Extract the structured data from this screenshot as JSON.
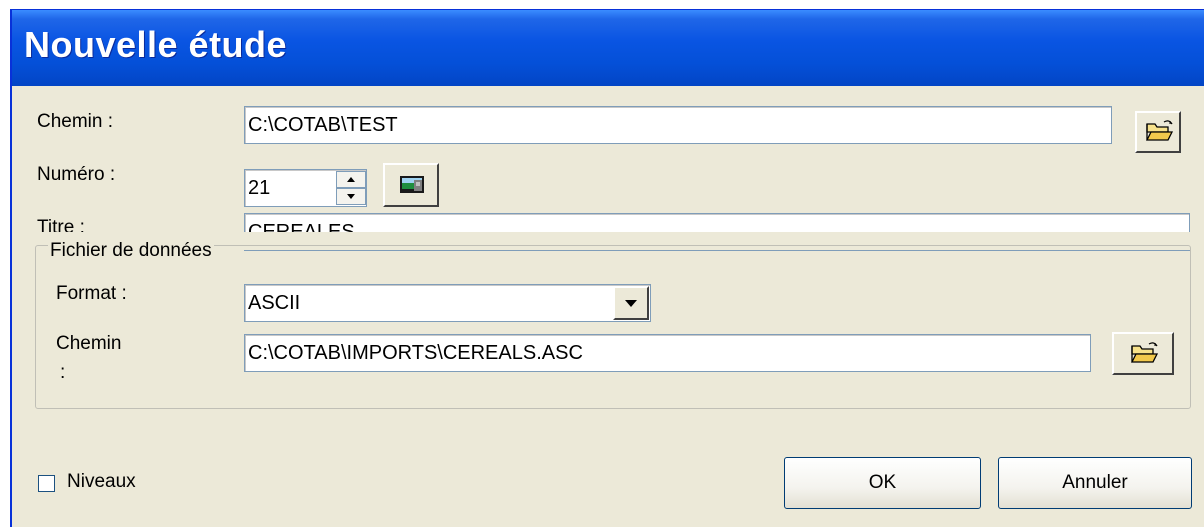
{
  "window": {
    "title": "Nouvelle étude"
  },
  "form": {
    "chemin_label": "Chemin :",
    "chemin_value": "C:\\COTAB\\TEST",
    "numero_label": "Numéro :",
    "numero_value": "21",
    "titre_label": "Titre :",
    "titre_value": "CEREALES"
  },
  "datafile": {
    "group_label": "Fichier de données",
    "format_label": "Format :",
    "format_value": "ASCII",
    "chemin_label_line1": "Chemin",
    "chemin_label_line2": ":",
    "chemin_value": "C:\\COTAB\\IMPORTS\\CEREALS.ASC"
  },
  "footer": {
    "niveaux_label": "Niveaux",
    "niveaux_checked": false,
    "ok_label": "OK",
    "cancel_label": "Annuler"
  },
  "icons": [
    "folder-open-icon",
    "spin-up-icon",
    "spin-down-icon",
    "picture-icon",
    "dropdown-arrow-icon"
  ]
}
